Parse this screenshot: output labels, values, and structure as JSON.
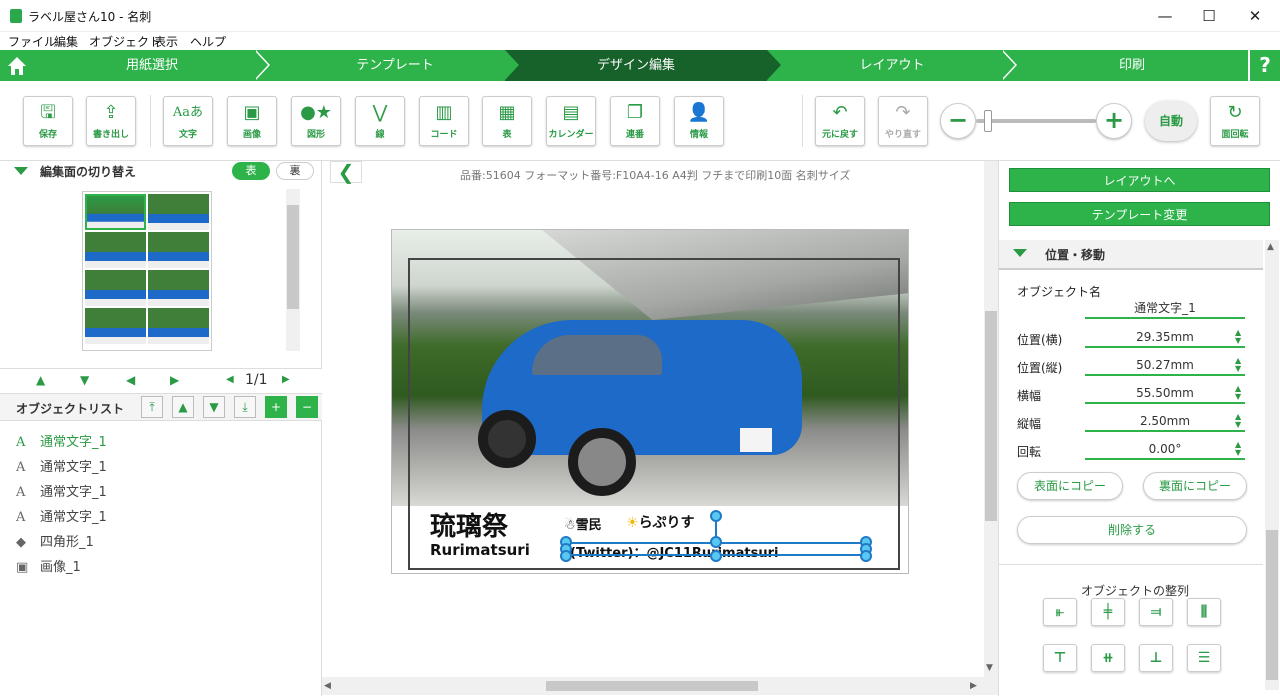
{
  "window": {
    "title": "ラベル屋さん10 - 名刺",
    "minimize": "—",
    "maximize": "☐",
    "close": "✕"
  },
  "menu": [
    "ファイル",
    "編集",
    "オブジェクト",
    "表示",
    "ヘルプ"
  ],
  "nav": {
    "steps": [
      "用紙選択",
      "テンプレート",
      "デザイン編集",
      "レイアウト",
      "印刷"
    ],
    "active": "デザイン編集",
    "help": "?"
  },
  "toolbar": {
    "buttons": [
      {
        "label": "保存",
        "icon": "save-icon"
      },
      {
        "label": "書き出し",
        "icon": "export-icon"
      },
      {
        "label": "文字",
        "icon": "text-icon",
        "glyph": "Aaあ"
      },
      {
        "label": "画像",
        "icon": "image-icon"
      },
      {
        "label": "図形",
        "icon": "shape-icon"
      },
      {
        "label": "線",
        "icon": "line-icon"
      },
      {
        "label": "コード",
        "icon": "barcode-icon"
      },
      {
        "label": "表",
        "icon": "table-icon"
      },
      {
        "label": "カレンダー",
        "icon": "calendar-icon"
      },
      {
        "label": "連番",
        "icon": "serial-number-icon"
      },
      {
        "label": "情報",
        "icon": "info-person-icon"
      }
    ],
    "undo": "元に戻す",
    "redo": "やり直す",
    "zoom_auto": "自動",
    "zoom_level": 0.1,
    "rotate": "面回転"
  },
  "left": {
    "switch_title": "編集面の切り替え",
    "front": "表",
    "back": "裏",
    "page": "1/1",
    "objlist_title": "オブジェクトリスト",
    "objects": [
      {
        "name": "通常文字_1",
        "icon": "A",
        "selected": true
      },
      {
        "name": "通常文字_1",
        "icon": "A",
        "selected": false
      },
      {
        "name": "通常文字_1",
        "icon": "A",
        "selected": false
      },
      {
        "name": "通常文字_1",
        "icon": "A",
        "selected": false
      },
      {
        "name": "四角形_1",
        "icon": "shape",
        "selected": false
      },
      {
        "name": "画像_1",
        "icon": "image",
        "selected": false
      }
    ]
  },
  "canvas": {
    "info": "品番:51604 フォーマット番号:F10A4-16 A4判 フチまで印刷10面 名刺サイズ",
    "card": {
      "title": "琉璃祭",
      "subtitle": "Rurimatsuri",
      "name1": "雪民",
      "name2": "らぷりす",
      "twitter": "(Twitter)：@JC11Rurimatsuri"
    }
  },
  "right": {
    "to_layout": "レイアウトへ",
    "change_template": "テンプレート変更",
    "section": "位置・移動",
    "objname_label": "オブジェクト名",
    "objname": "通常文字_1",
    "props": [
      {
        "label": "位置(横)",
        "value": "29.35mm"
      },
      {
        "label": "位置(縦)",
        "value": "50.27mm"
      },
      {
        "label": "横幅",
        "value": "55.50mm"
      },
      {
        "label": "縦幅",
        "value": "2.50mm"
      },
      {
        "label": "回転",
        "value": "0.00°"
      }
    ],
    "copy_front": "表面にコピー",
    "copy_back": "裏面にコピー",
    "delete": "削除する",
    "align_title": "オブジェクトの整列"
  },
  "colors": {
    "accent": "#2db34a",
    "nav_active": "#17612a",
    "selection": "#1f7ac8"
  }
}
